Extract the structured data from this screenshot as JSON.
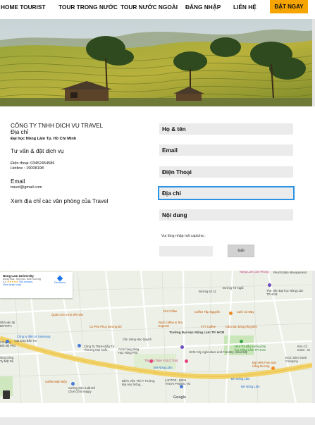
{
  "nav": {
    "items": [
      "HOME TOURIST",
      "TOUR TRONG NƯỚC",
      "TOUR NƯỚC NGOÀI",
      "ĐĂNG NHẬP",
      "LIÊN HỆ"
    ],
    "cta": "ĐẶT NGAY"
  },
  "hero": {
    "image": "rice-terraces-landscape"
  },
  "info": {
    "company": "CÔNG TY TNHH DỊCH VỤ  TRAVEL",
    "address_label": "Địa chỉ",
    "address": "Đại học Nông Lâm  Tp. Hồ Chí Minh",
    "consult": "Tư vấn & đặt dịch vụ",
    "phone": "Điện thoại: 03452454586",
    "hotline": "Hotline    : 19008198",
    "email_label": "Email",
    "email": "travel@gmail.com",
    "offices_link": "Xem địa chỉ các văn phòng của Travel"
  },
  "form": {
    "fields": [
      "Họ & tên",
      "Email",
      "Điện Thoại",
      "Địa chỉ",
      "Nội dung"
    ],
    "captcha_text": "Vui lòng nhập mã captcha :",
    "submit": "Gửi"
  },
  "map": {
    "card": {
      "title": "Nong Lam University",
      "address": "Đông Hoà, Thủ Đức, Bình Dương",
      "rating": "4.4",
      "stars": "★★★★★",
      "reviews": "508 reviews",
      "larger": "View larger map",
      "directions": "Directions"
    },
    "labels": [
      "Trường Đại Học Nông Lâm TP. HCM",
      "HCM City Agriculture and Forestry University",
      "Nhà Thi đấu trường Đại học Nông Lâm TP.HCM",
      "Real Estate Management",
      "Thư viện Đại học Nông Lâm TP.HCM",
      "Coffee Tấp Nguyên",
      "Cafe Cỏ May",
      "Ruổi Coffee & Tea Express",
      "FTT Coffee",
      "Cẩm sản bóng rổng bền",
      "DH Coffee",
      "Co Phe Phuy Dương Đỏ",
      "Quán cơm cơm tiền sản",
      "Căn Hàng Học Quynh",
      "Công Ty TNHH Đầu Tư Thương Mại Xuất...",
      "Cơm hàng răng Học Hùng Phú",
      "Trà sữa Toon Vi (LG Trai)",
      "ĐH Nông Lâm",
      "Bệnh Viện Thú Y Trường Đại Học Nông...",
      "LAPTOP - ĐIỆN THOẠI PHONG VŨ",
      "Đại Hiền Five Star Hồng Dương",
      "ECE Joint Stock Company",
      "Khu Cô Intem - Ei",
      "Xưởng Sản Xuất Đồ Chơi Gỗ 8.Happy",
      "Coffee Mặn Mộn",
      "Vua Dưa Bến Tre",
      "Công ty điện tử Samsung",
      "Nhà vận tải BOTOFA",
      "Ông Công Ty Mặt Dá",
      "Công Ty Đệt Mỹ Phú",
      "Đường Tử Ngãi",
      "Đường số 12",
      "Google",
      "Nong Lâm Căn Phòng",
      "ĐH Nông Lâm",
      "ĐH Nông Lâm"
    ]
  }
}
